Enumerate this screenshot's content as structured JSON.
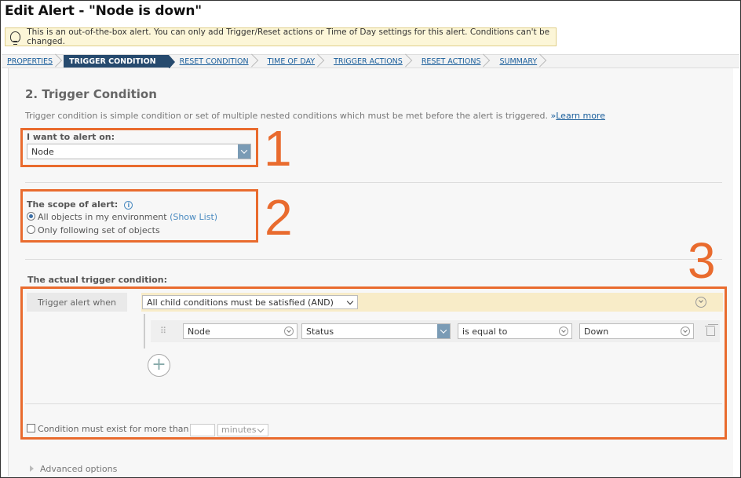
{
  "title": "Edit Alert - \"Node is down\"",
  "notice": {
    "icon": "lightbulb-icon",
    "text": "This is an out-of-the-box alert. You can only add Trigger/Reset actions or Time of Day settings for this alert. Conditions can't be changed."
  },
  "steps": [
    {
      "label": "PROPERTIES",
      "active": false
    },
    {
      "label": "TRIGGER CONDITION",
      "active": true
    },
    {
      "label": "RESET CONDITION",
      "active": false
    },
    {
      "label": "TIME OF DAY",
      "active": false
    },
    {
      "label": "TRIGGER ACTIONS",
      "active": false
    },
    {
      "label": "RESET ACTIONS",
      "active": false
    },
    {
      "label": "SUMMARY",
      "active": false
    }
  ],
  "section": {
    "heading": "2. Trigger Condition",
    "description": "Trigger condition is simple condition or set of multiple nested conditions which must be met before the alert is triggered.",
    "learn_more_prefix": "»",
    "learn_more": "Learn more"
  },
  "alert_on": {
    "label": "I want to alert on:",
    "value": "Node"
  },
  "scope": {
    "label": "The scope of alert:",
    "option_all": "All objects in my environment",
    "show_list": "(Show List)",
    "option_following": "Only following set of objects"
  },
  "trigger": {
    "label": "The actual trigger condition:",
    "when_label": "Trigger alert when",
    "group_select": "All child conditions must be satisfied (AND)",
    "condition": {
      "object": "Node",
      "field": "Status",
      "operator": "is equal to",
      "value": "Down"
    },
    "exist_label": "Condition must exist for more than",
    "unit": "minutes"
  },
  "advanced": "Advanced options",
  "annotations": [
    "1",
    "2",
    "3"
  ],
  "colors": {
    "annotation": "#e96b2e",
    "active_step": "#264a6e",
    "link": "#1a5e9b",
    "notice_bg": "#fcf6d8"
  }
}
